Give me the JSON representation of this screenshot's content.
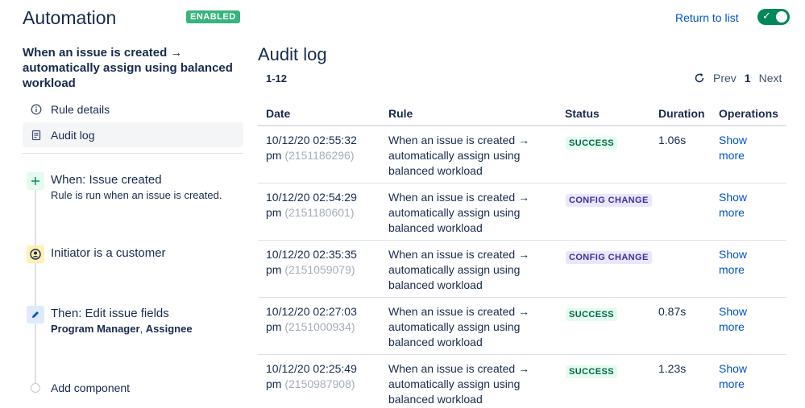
{
  "header": {
    "title": "Automation",
    "badge": "ENABLED",
    "return_link": "Return to list"
  },
  "sidebar": {
    "rule_title": "When an issue is created → automatically assign using balanced workload",
    "nav": [
      {
        "label": "Rule details",
        "icon": "info-icon"
      },
      {
        "label": "Audit log",
        "icon": "document-icon"
      }
    ],
    "components": [
      {
        "title": "When: Issue created",
        "subtitle": "Rule is run when an issue is created.",
        "icon": "plus-icon",
        "color": "#E3FCEF"
      },
      {
        "title": "Initiator is a customer",
        "icon": "user-circle-icon",
        "color": "#FFF0B3"
      },
      {
        "title": "Then: Edit issue fields",
        "fields": [
          "Program Manager",
          "Assignee"
        ],
        "separator": ", ",
        "icon": "pencil-icon",
        "color": "#DEEBFF"
      }
    ],
    "add_component": "Add component"
  },
  "main": {
    "title": "Audit log",
    "range": "1-12",
    "pager": {
      "prev": "Prev",
      "page": "1",
      "next": "Next"
    },
    "columns": [
      "Date",
      "Rule",
      "Status",
      "Duration",
      "Operations"
    ],
    "rows": [
      {
        "date": "10/12/20 02:55:32",
        "ampm": "pm",
        "id": "(2151186296)",
        "rule": "When an issue is created → automatically assign using balanced workload",
        "status": "SUCCESS",
        "status_type": "success",
        "duration": "1.06s",
        "ops": "Show more"
      },
      {
        "date": "10/12/20 02:54:29",
        "ampm": "pm",
        "id": "(2151180601)",
        "rule": "When an issue is created → automatically assign using balanced workload",
        "status": "CONFIG CHANGE",
        "status_type": "config",
        "duration": "",
        "ops": "Show more"
      },
      {
        "date": "10/12/20 02:35:35",
        "ampm": "pm",
        "id": "(2151059079)",
        "rule": "When an issue is created → automatically assign using balanced workload",
        "status": "CONFIG CHANGE",
        "status_type": "config",
        "duration": "",
        "ops": "Show more"
      },
      {
        "date": "10/12/20 02:27:03",
        "ampm": "pm",
        "id": "(2151000934)",
        "rule": "When an issue is created → automatically assign using balanced workload",
        "status": "SUCCESS",
        "status_type": "success",
        "duration": "0.87s",
        "ops": "Show more"
      },
      {
        "date": "10/12/20 02:25:49",
        "ampm": "pm",
        "id": "(2150987908)",
        "rule": "When an issue is created → automatically assign using balanced workload",
        "status": "SUCCESS",
        "status_type": "success",
        "duration": "1.23s",
        "ops": "Show more"
      }
    ]
  },
  "colors": {
    "accent": "#0052CC",
    "toggle_on": "#00875A",
    "enabled_badge": "#36B37E",
    "success_bg": "#E3FCEF",
    "success_fg": "#006644",
    "config_bg": "#EAE6FF",
    "config_fg": "#403294"
  }
}
